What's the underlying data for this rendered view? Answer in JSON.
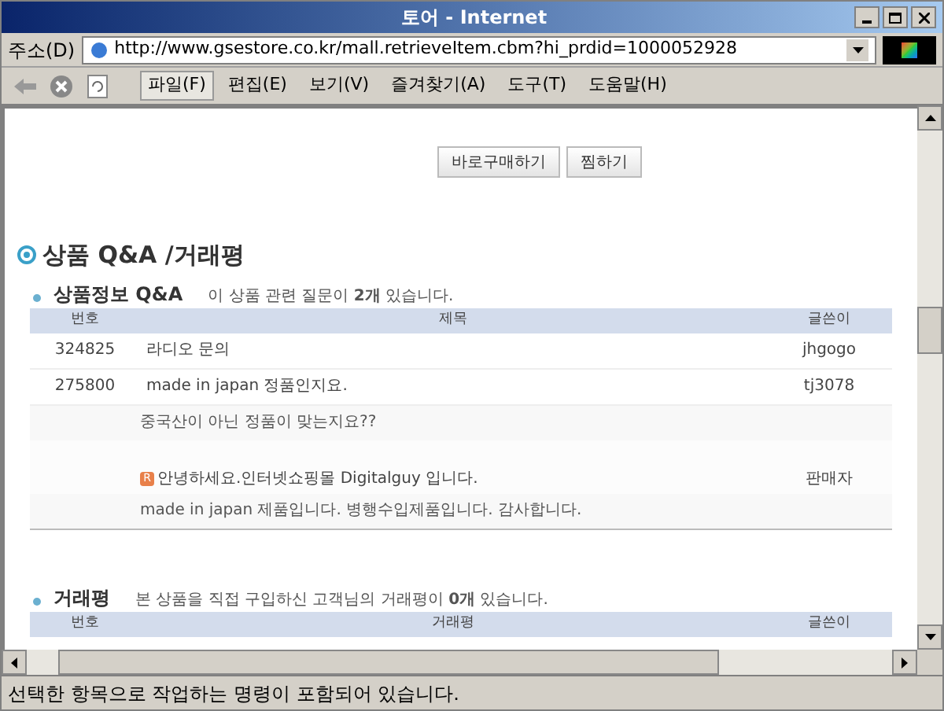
{
  "window": {
    "title": "토어 - Internet"
  },
  "address_bar": {
    "label": "주소(D)",
    "url": "http://www.gsestore.co.kr/mall.retrieveItem.cbm?hi_prdid=1000052928"
  },
  "menu": [
    {
      "label": "파일(F)",
      "selected": true
    },
    {
      "label": "편집(E)",
      "selected": false
    },
    {
      "label": "보기(V)",
      "selected": false
    },
    {
      "label": "즐겨찾기(A)",
      "selected": false
    },
    {
      "label": "도구(T)",
      "selected": false
    },
    {
      "label": "도움말(H)",
      "selected": false
    }
  ],
  "buttons": [
    "바로구매하기",
    "찜하기"
  ],
  "section_title": "상품 Q&A /거래평",
  "qa": {
    "title": "상품정보 Q&A",
    "summary": "이 상품 관련 질문이 **2개** 있습니다.",
    "columns": [
      "번호",
      "제목",
      "글쓴이"
    ],
    "rows": [
      {
        "kind": "question",
        "number": "324825",
        "title": "라디오 문의",
        "author": "jhgogo"
      },
      {
        "kind": "question",
        "number": "275800",
        "title": "made in japan 정품인지요.",
        "author": "tj3078"
      },
      {
        "kind": "body",
        "text": "중국산이 아닌 정품이 맞는지요??"
      },
      {
        "kind": "reply",
        "title": "안녕하세요.인터넷쇼핑몰 Digitalguy 입니다.",
        "author": "판매자",
        "badge": "R"
      },
      {
        "kind": "body",
        "text": "made in japan 제품입니다. 병행수입제품입니다. 감사합니다."
      }
    ]
  },
  "reviews": {
    "title": "거래평",
    "summary": "본 상품을 직접 구입하신 고객님의 거래평이 **0개** 있습니다.",
    "columns": [
      "번호",
      "거래평",
      "글쓴이"
    ]
  },
  "status_bar": {
    "text": "선택한 항목으로 작업하는 명령이 포함되어 있습니다."
  }
}
